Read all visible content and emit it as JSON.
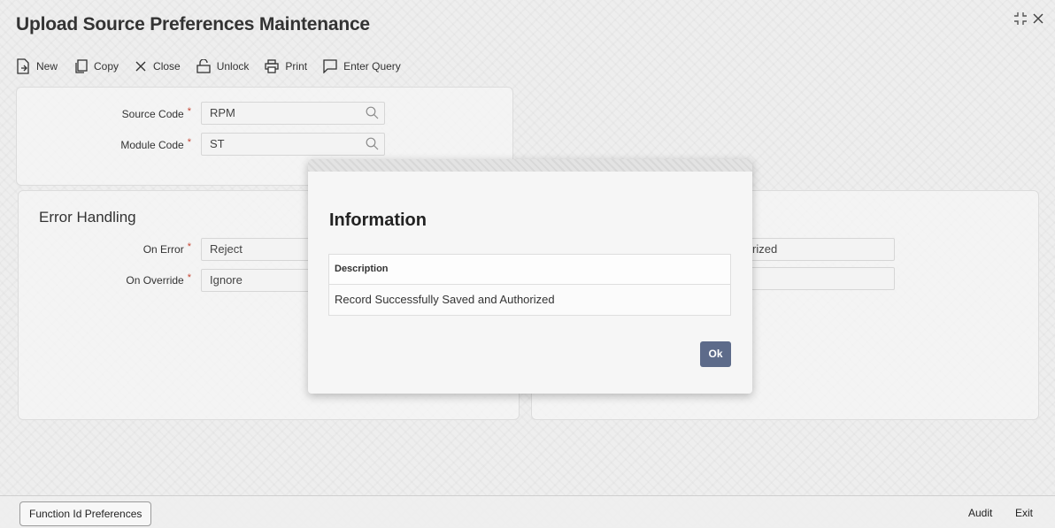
{
  "window": {
    "title": "Upload Source Preferences Maintenance",
    "controls": {
      "expand_icon": "expand-icon",
      "close_icon": "close-icon"
    }
  },
  "toolbar": {
    "new_label": "New",
    "copy_label": "Copy",
    "close_label": "Close",
    "unlock_label": "Unlock",
    "print_label": "Print",
    "enter_query_label": "Enter Query"
  },
  "header_form": {
    "source_code": {
      "label": "Source Code",
      "value": "RPM"
    },
    "module_code": {
      "label": "Module Code",
      "value": "ST"
    }
  },
  "error_handling": {
    "title": "Error Handling",
    "on_error": {
      "label": "On Error",
      "value": "Reject"
    },
    "on_override": {
      "label": "On Override",
      "value": "Ignore"
    }
  },
  "right_panel": {
    "field1_visible_value": "rized",
    "field2_visible_value": ""
  },
  "footer": {
    "function_id_prefs_label": "Function Id Preferences",
    "audit_label": "Audit",
    "exit_label": "Exit"
  },
  "modal": {
    "title": "Information",
    "table_header": "Description",
    "message": "Record Successfully Saved and Authorized",
    "ok_label": "Ok"
  },
  "colors": {
    "primary_button": "#5d6b8a",
    "required_star": "#c74634"
  }
}
